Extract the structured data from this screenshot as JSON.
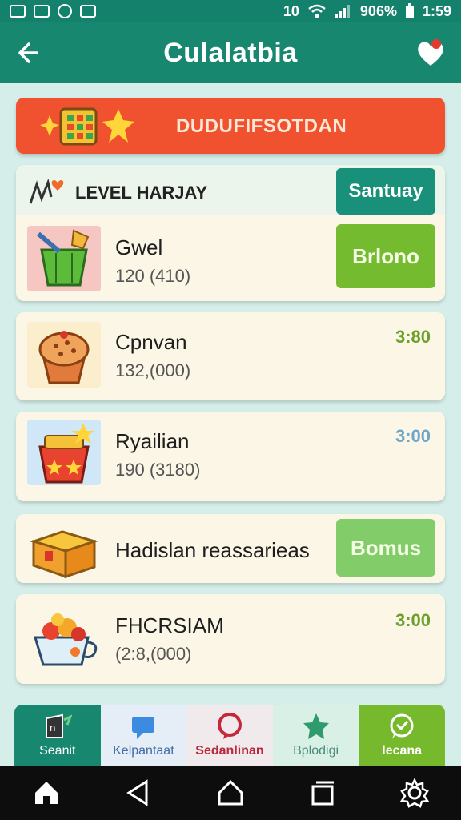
{
  "statusbar": {
    "network": "10",
    "battery": "906%",
    "time": "1:59"
  },
  "header": {
    "title": "Culalatbia"
  },
  "banner": {
    "text": "DUDUFIFSOTDAN"
  },
  "level_card": {
    "title": "LEVEL HARJAY",
    "top_button": "Santuay",
    "item": {
      "name": "Gwel",
      "sub": "120 (410)",
      "button": "Brlono"
    }
  },
  "items": [
    {
      "name": "Cpnvan",
      "sub": "132,(000)",
      "time": "3:80",
      "time_color": "#6aa12a"
    },
    {
      "name": "Ryailian",
      "sub": "190 (3180)",
      "time": "3:00",
      "time_color": "#6fa6c9"
    },
    {
      "name": "Hadislan reassarieas",
      "sub": "",
      "button": "Bomus"
    },
    {
      "name": "FHCRSIAM",
      "sub": "(2:8,(000)",
      "time": "3:00",
      "time_color": "#6aa12a"
    }
  ],
  "tabs": [
    {
      "label": "Seanit"
    },
    {
      "label": "Kelpantaat"
    },
    {
      "label": "Sedanlinan"
    },
    {
      "label": "Bplodigi"
    },
    {
      "label": "lecana"
    }
  ],
  "colors": {
    "primary": "#17876f",
    "banner": "#f0522f",
    "accent_green": "#75bb2f"
  }
}
